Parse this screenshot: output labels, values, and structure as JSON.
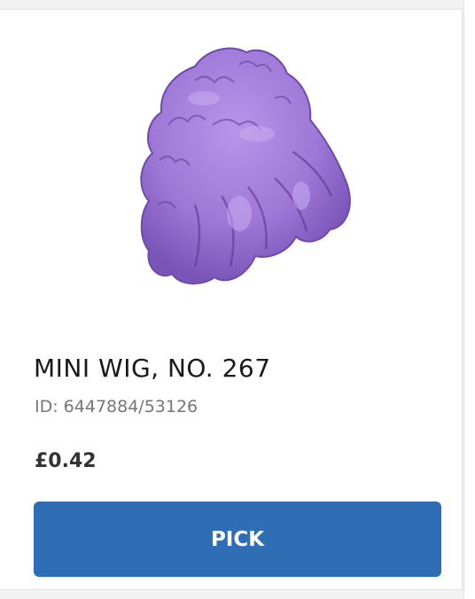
{
  "product": {
    "title": "MINI WIG, NO. 267",
    "id_text": "ID: 6447884/53126",
    "price": "£0.42",
    "image_icon": "purple-wig-icon",
    "image_color": "#a07ad8"
  },
  "actions": {
    "pick_label": "PICK",
    "pick_color": "#2f6db4"
  }
}
